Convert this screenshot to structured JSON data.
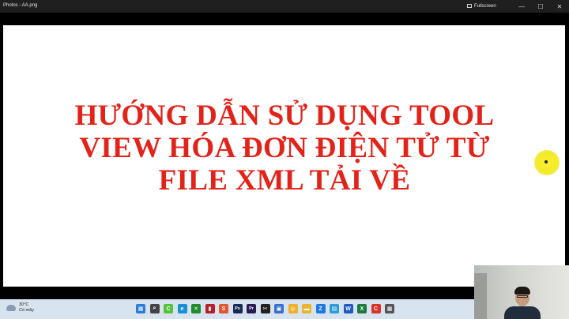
{
  "window": {
    "title": "Photos - AA.png",
    "fullscreen_label": "Fullscreen",
    "minimize_glyph": "—",
    "maximize_glyph": "☐",
    "close_glyph": "✕"
  },
  "slide": {
    "lines": [
      "HƯỚNG DẪN SỬ DỤNG TOOL",
      "VIEW HÓA ĐƠN ĐIỆN TỬ TỪ",
      "FILE XML TẢI VỀ"
    ],
    "text_color": "#e2231a"
  },
  "taskbar": {
    "weather_temp": "30°C",
    "weather_desc": "Có mây",
    "icons": [
      {
        "name": "start-icon",
        "color": "#2b7bd9",
        "glyph": "▦"
      },
      {
        "name": "search-icon",
        "color": "#444",
        "glyph": "⌕"
      },
      {
        "name": "cc-icon",
        "color": "#55c23a",
        "glyph": "C"
      },
      {
        "name": "edge-icon",
        "color": "#1b8fd6",
        "glyph": "e"
      },
      {
        "name": "xbox-icon",
        "color": "#1f8a2f",
        "glyph": "✕"
      },
      {
        "name": "office-icon",
        "color": "#b3202a",
        "glyph": "▮"
      },
      {
        "name": "app-s-icon",
        "color": "#e4562d",
        "glyph": "S"
      },
      {
        "name": "photoshop-icon",
        "color": "#1a2b52",
        "glyph": "Ps"
      },
      {
        "name": "premiere-icon",
        "color": "#2a1a52",
        "glyph": "Pr"
      },
      {
        "name": "capcut-icon",
        "color": "#222",
        "glyph": "✂"
      },
      {
        "name": "store-icon",
        "color": "#3a6fd1",
        "glyph": "▣"
      },
      {
        "name": "clipchamp-icon",
        "color": "#f0b02a",
        "glyph": "◎"
      },
      {
        "name": "folder-icon",
        "color": "#e9b52f",
        "glyph": "▬"
      },
      {
        "name": "zalo-icon",
        "color": "#1e78e0",
        "glyph": "Z"
      },
      {
        "name": "explorer-icon",
        "color": "#2d9bd6",
        "glyph": "▤"
      },
      {
        "name": "word-icon",
        "color": "#1f5bbf",
        "glyph": "W"
      },
      {
        "name": "excel-icon",
        "color": "#1d7a3f",
        "glyph": "X"
      },
      {
        "name": "app-c-icon",
        "color": "#d9332a",
        "glyph": "C"
      },
      {
        "name": "calc-icon",
        "color": "#555",
        "glyph": "▦"
      }
    ],
    "tray": {
      "time": "",
      "date": ""
    }
  },
  "accent": {
    "highlight": "#f3ea2a",
    "taskbar_bg": "#d8e3f0"
  }
}
